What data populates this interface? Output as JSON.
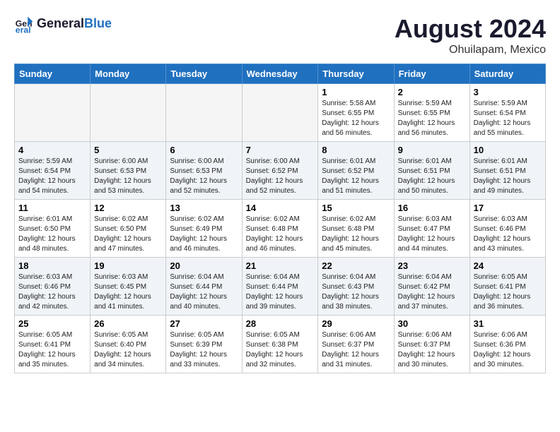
{
  "header": {
    "logo_general": "General",
    "logo_blue": "Blue",
    "title": "August 2024",
    "subtitle": "Ohuilapam, Mexico"
  },
  "days_of_week": [
    "Sunday",
    "Monday",
    "Tuesday",
    "Wednesday",
    "Thursday",
    "Friday",
    "Saturday"
  ],
  "weeks": [
    [
      {
        "day": "",
        "info": ""
      },
      {
        "day": "",
        "info": ""
      },
      {
        "day": "",
        "info": ""
      },
      {
        "day": "",
        "info": ""
      },
      {
        "day": "1",
        "info": "Sunrise: 5:58 AM\nSunset: 6:55 PM\nDaylight: 12 hours\nand 56 minutes."
      },
      {
        "day": "2",
        "info": "Sunrise: 5:59 AM\nSunset: 6:55 PM\nDaylight: 12 hours\nand 56 minutes."
      },
      {
        "day": "3",
        "info": "Sunrise: 5:59 AM\nSunset: 6:54 PM\nDaylight: 12 hours\nand 55 minutes."
      }
    ],
    [
      {
        "day": "4",
        "info": "Sunrise: 5:59 AM\nSunset: 6:54 PM\nDaylight: 12 hours\nand 54 minutes."
      },
      {
        "day": "5",
        "info": "Sunrise: 6:00 AM\nSunset: 6:53 PM\nDaylight: 12 hours\nand 53 minutes."
      },
      {
        "day": "6",
        "info": "Sunrise: 6:00 AM\nSunset: 6:53 PM\nDaylight: 12 hours\nand 52 minutes."
      },
      {
        "day": "7",
        "info": "Sunrise: 6:00 AM\nSunset: 6:52 PM\nDaylight: 12 hours\nand 52 minutes."
      },
      {
        "day": "8",
        "info": "Sunrise: 6:01 AM\nSunset: 6:52 PM\nDaylight: 12 hours\nand 51 minutes."
      },
      {
        "day": "9",
        "info": "Sunrise: 6:01 AM\nSunset: 6:51 PM\nDaylight: 12 hours\nand 50 minutes."
      },
      {
        "day": "10",
        "info": "Sunrise: 6:01 AM\nSunset: 6:51 PM\nDaylight: 12 hours\nand 49 minutes."
      }
    ],
    [
      {
        "day": "11",
        "info": "Sunrise: 6:01 AM\nSunset: 6:50 PM\nDaylight: 12 hours\nand 48 minutes."
      },
      {
        "day": "12",
        "info": "Sunrise: 6:02 AM\nSunset: 6:50 PM\nDaylight: 12 hours\nand 47 minutes."
      },
      {
        "day": "13",
        "info": "Sunrise: 6:02 AM\nSunset: 6:49 PM\nDaylight: 12 hours\nand 46 minutes."
      },
      {
        "day": "14",
        "info": "Sunrise: 6:02 AM\nSunset: 6:48 PM\nDaylight: 12 hours\nand 46 minutes."
      },
      {
        "day": "15",
        "info": "Sunrise: 6:02 AM\nSunset: 6:48 PM\nDaylight: 12 hours\nand 45 minutes."
      },
      {
        "day": "16",
        "info": "Sunrise: 6:03 AM\nSunset: 6:47 PM\nDaylight: 12 hours\nand 44 minutes."
      },
      {
        "day": "17",
        "info": "Sunrise: 6:03 AM\nSunset: 6:46 PM\nDaylight: 12 hours\nand 43 minutes."
      }
    ],
    [
      {
        "day": "18",
        "info": "Sunrise: 6:03 AM\nSunset: 6:46 PM\nDaylight: 12 hours\nand 42 minutes."
      },
      {
        "day": "19",
        "info": "Sunrise: 6:03 AM\nSunset: 6:45 PM\nDaylight: 12 hours\nand 41 minutes."
      },
      {
        "day": "20",
        "info": "Sunrise: 6:04 AM\nSunset: 6:44 PM\nDaylight: 12 hours\nand 40 minutes."
      },
      {
        "day": "21",
        "info": "Sunrise: 6:04 AM\nSunset: 6:44 PM\nDaylight: 12 hours\nand 39 minutes."
      },
      {
        "day": "22",
        "info": "Sunrise: 6:04 AM\nSunset: 6:43 PM\nDaylight: 12 hours\nand 38 minutes."
      },
      {
        "day": "23",
        "info": "Sunrise: 6:04 AM\nSunset: 6:42 PM\nDaylight: 12 hours\nand 37 minutes."
      },
      {
        "day": "24",
        "info": "Sunrise: 6:05 AM\nSunset: 6:41 PM\nDaylight: 12 hours\nand 36 minutes."
      }
    ],
    [
      {
        "day": "25",
        "info": "Sunrise: 6:05 AM\nSunset: 6:41 PM\nDaylight: 12 hours\nand 35 minutes."
      },
      {
        "day": "26",
        "info": "Sunrise: 6:05 AM\nSunset: 6:40 PM\nDaylight: 12 hours\nand 34 minutes."
      },
      {
        "day": "27",
        "info": "Sunrise: 6:05 AM\nSunset: 6:39 PM\nDaylight: 12 hours\nand 33 minutes."
      },
      {
        "day": "28",
        "info": "Sunrise: 6:05 AM\nSunset: 6:38 PM\nDaylight: 12 hours\nand 32 minutes."
      },
      {
        "day": "29",
        "info": "Sunrise: 6:06 AM\nSunset: 6:37 PM\nDaylight: 12 hours\nand 31 minutes."
      },
      {
        "day": "30",
        "info": "Sunrise: 6:06 AM\nSunset: 6:37 PM\nDaylight: 12 hours\nand 30 minutes."
      },
      {
        "day": "31",
        "info": "Sunrise: 6:06 AM\nSunset: 6:36 PM\nDaylight: 12 hours\nand 30 minutes."
      }
    ]
  ]
}
